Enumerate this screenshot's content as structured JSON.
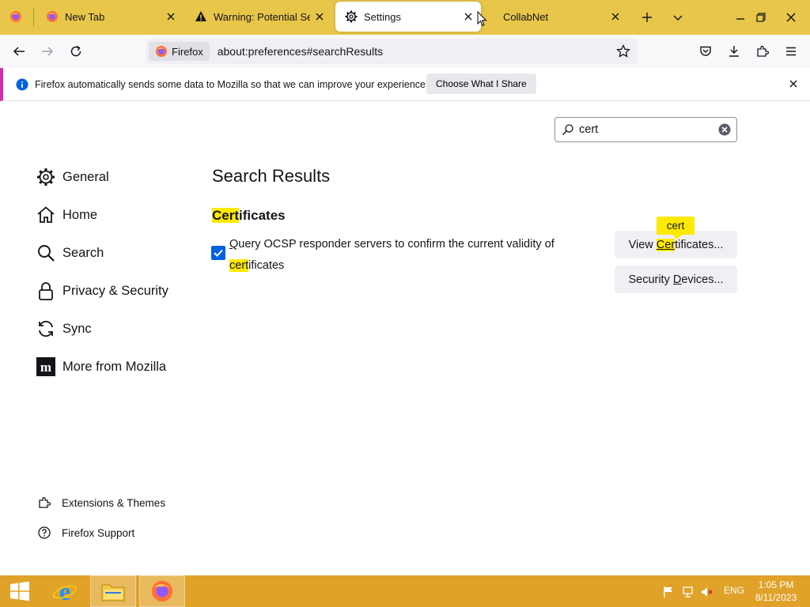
{
  "tabs": [
    {
      "label": "",
      "icon": "firefox-icon"
    },
    {
      "label": "New Tab",
      "icon": "firefox-icon"
    },
    {
      "label": "Warning: Potential Secu",
      "icon": "warning-icon"
    },
    {
      "label": "Settings",
      "icon": "gear-icon",
      "selected": true
    },
    {
      "label": "CollabNet",
      "icon": "page-icon"
    }
  ],
  "urlbar": {
    "identity_label": "Firefox",
    "url": "about:preferences#searchResults"
  },
  "notification": {
    "text": "Firefox automatically sends some data to Mozilla so that we can improve your experience.",
    "button_label": "Choose What I Share"
  },
  "search": {
    "value": "cert"
  },
  "sidebar": {
    "categories": [
      {
        "label": "General",
        "icon": "gear-icon"
      },
      {
        "label": "Home",
        "icon": "home-icon"
      },
      {
        "label": "Search",
        "icon": "search-icon"
      },
      {
        "label": "Privacy & Security",
        "icon": "lock-icon"
      },
      {
        "label": "Sync",
        "icon": "sync-icon"
      },
      {
        "label": "More from Mozilla",
        "icon": "mozilla-icon"
      }
    ],
    "bottom_links": [
      {
        "label": "Extensions & Themes",
        "icon": "puzzle-icon"
      },
      {
        "label": "Firefox Support",
        "icon": "help-icon"
      }
    ]
  },
  "main": {
    "results_title": "Search Results",
    "section_heading_highlight": "Cert",
    "section_heading_rest": "ificates",
    "ocsp_label_pre": "uery OCSP responder servers to confirm the current validity of ",
    "ocsp_label_access": "Q",
    "ocsp_label_highlight": "cert",
    "ocsp_label_post": "ificates",
    "ocsp_checked": true,
    "view_btn_pre": "View ",
    "view_btn_highlight": "Cer",
    "view_btn_post": "tificates...",
    "security_btn_pre": "Security ",
    "security_btn_access": "D",
    "security_btn_post": "evices...",
    "tooltip": "cert"
  },
  "taskbar": {
    "lang": "ENG",
    "time": "1:05 PM",
    "date": "8/11/2023"
  },
  "colors": {
    "tabstrip": "#e8c64a",
    "highlight": "#ffe900",
    "checkbox": "#0061e0",
    "taskbar": "#e0a228",
    "notification_accent": "#d52bad"
  }
}
